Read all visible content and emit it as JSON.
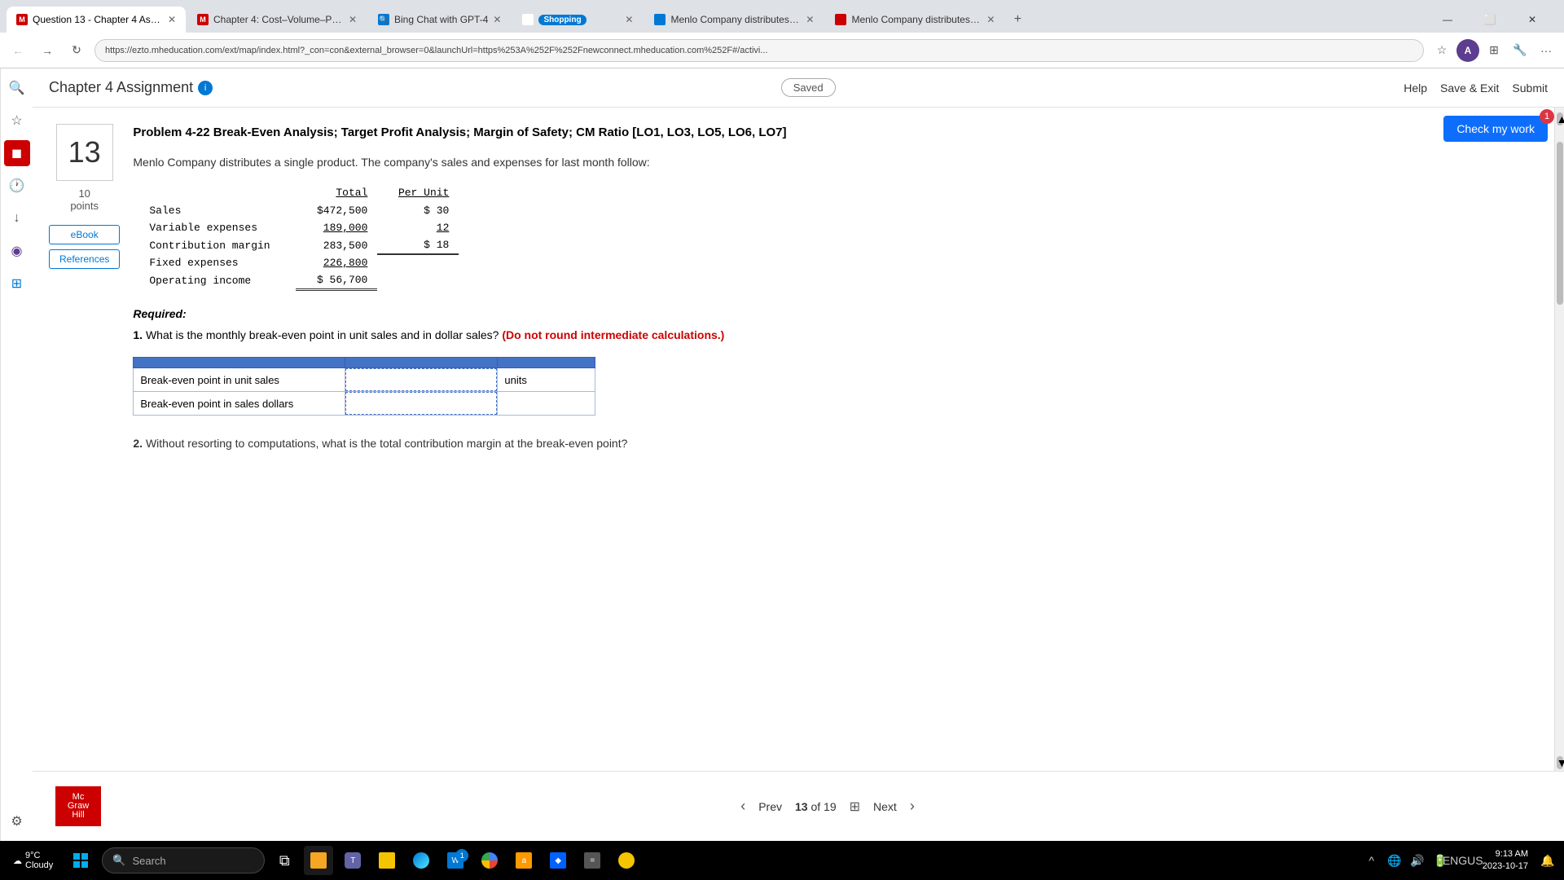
{
  "browser": {
    "tabs": [
      {
        "id": "tab1",
        "label": "Question 13 - Chapter 4 Assi...",
        "favicon": "M",
        "active": true,
        "favicon_type": "m-icon"
      },
      {
        "id": "tab2",
        "label": "Chapter 4: Cost–Volume–Profi...",
        "favicon": "M",
        "active": false,
        "favicon_type": "ch-icon"
      },
      {
        "id": "tab3",
        "label": "Bing Chat with GPT-4",
        "favicon": "B",
        "active": false,
        "favicon_type": "bing-icon"
      },
      {
        "id": "tab4",
        "label": "Shopping",
        "favicon": "S",
        "active": false,
        "favicon_type": "shop-icon",
        "badge": true
      },
      {
        "id": "tab5",
        "label": "Menlo Company distributes a...",
        "favicon": "M",
        "active": false,
        "favicon_type": "menlo-icon"
      },
      {
        "id": "tab6",
        "label": "Menlo Company distributes a...",
        "favicon": "M",
        "active": false,
        "favicon_type": "menlo-icon"
      }
    ],
    "url": "https://ezto.mheducation.com/ext/map/index.html?_con=con&external_browser=0&launchUrl=https%253A%252F%252Fnewconnect.mheducation.com%252F#/activi...",
    "window_controls": [
      "—",
      "⬜",
      "✕"
    ]
  },
  "header": {
    "title": "Chapter 4 Assignment",
    "info_icon": "i",
    "saved_label": "Saved",
    "help_label": "Help",
    "save_exit_label": "Save & Exit",
    "submit_label": "Submit",
    "check_my_work_label": "Check my work",
    "check_badge": "1"
  },
  "sidebar": {
    "ebook_label": "eBook",
    "references_label": "References"
  },
  "question": {
    "number": "13",
    "points": "10",
    "points_label": "points",
    "title": "Problem 4-22 Break-Even Analysis; Target Profit Analysis; Margin of Safety; CM Ratio [LO1, LO3, LO5, LO6, LO7]",
    "description": "Menlo Company distributes a single product. The company's sales and expenses for last month follow:",
    "table": {
      "headers": [
        "",
        "Total",
        "Per Unit"
      ],
      "rows": [
        {
          "label": "Sales",
          "total": "$472,500",
          "per_unit": "$ 30"
        },
        {
          "label": "Variable expenses",
          "total": "189,000",
          "per_unit": "12"
        },
        {
          "label": "Contribution margin",
          "total": "283,500",
          "per_unit": "$ 18"
        },
        {
          "label": "Fixed expenses",
          "total": "226,800",
          "per_unit": ""
        },
        {
          "label": "Operating income",
          "total": "$ 56,700",
          "per_unit": ""
        }
      ]
    },
    "required_label": "Required:",
    "questions": [
      {
        "num": "1.",
        "text": "What is the monthly break-even point in unit sales and in dollar sales?",
        "highlight": "(Do not round intermediate calculations.)"
      },
      {
        "num": "2.",
        "text": "Without resorting to computations, what is the total contribution margin at the break-even point?"
      }
    ],
    "answer_table": {
      "col1_header": "",
      "col2_header": "",
      "col3_header": "",
      "rows": [
        {
          "label": "Break-even point in unit sales",
          "value": "",
          "unit": "units"
        },
        {
          "label": "Break-even point in sales dollars",
          "value": "",
          "unit": ""
        }
      ]
    }
  },
  "pagination": {
    "prev_label": "Prev",
    "next_label": "Next",
    "current": "13",
    "total": "19"
  },
  "taskbar": {
    "search_placeholder": "Search",
    "time": "9:13 AM",
    "date": "2023-10-17",
    "weather_temp": "9°C",
    "weather_desc": "Cloudy",
    "eng_label": "ENG",
    "us_label": "US",
    "notification_count": "1"
  }
}
